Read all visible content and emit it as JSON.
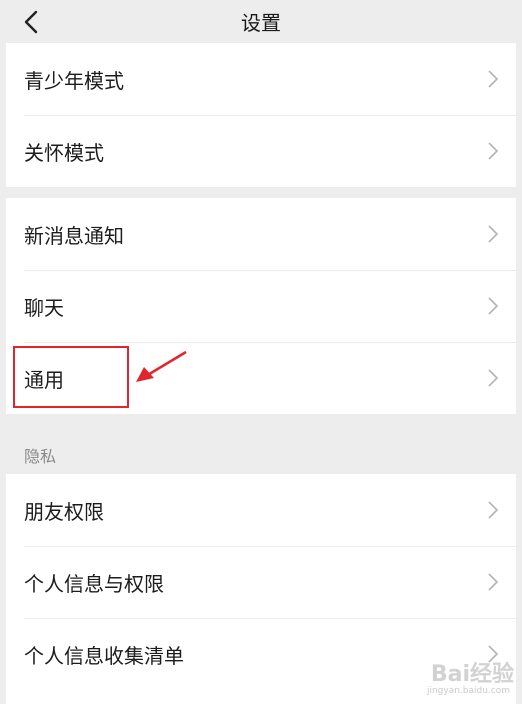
{
  "header": {
    "title": "设置"
  },
  "groups": [
    {
      "items": [
        {
          "label": "青少年模式"
        },
        {
          "label": "关怀模式"
        }
      ]
    },
    {
      "items": [
        {
          "label": "新消息通知"
        },
        {
          "label": "聊天"
        },
        {
          "label": "通用"
        }
      ]
    },
    {
      "section_label": "隐私",
      "items": [
        {
          "label": "朋友权限"
        },
        {
          "label": "个人信息与权限"
        },
        {
          "label": "个人信息收集清单"
        }
      ]
    }
  ],
  "annotation": {
    "color": "#e0262d"
  },
  "watermark": {
    "text": "Bai经验",
    "sub": "jingyan.baidu.com"
  },
  "icons": {
    "back": "chevron-left-icon",
    "row": "chevron-right-icon"
  }
}
